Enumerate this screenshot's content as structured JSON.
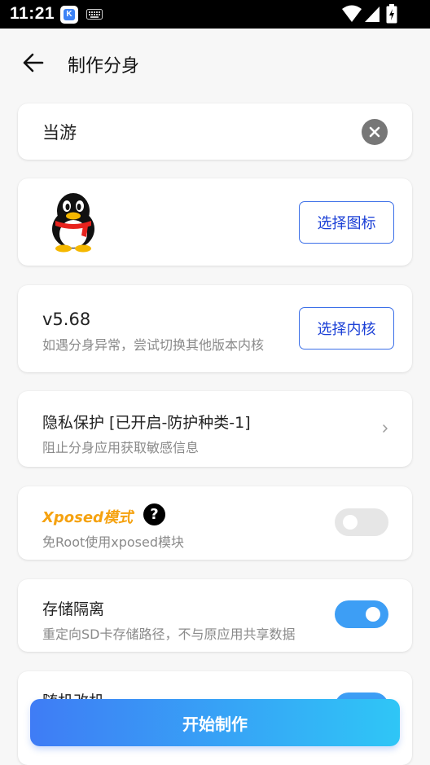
{
  "status_bar": {
    "time": "11:21",
    "app_icon_letter": "K",
    "icons": [
      "app-notification-icon",
      "keyboard-icon",
      "wifi-icon",
      "signal-icon",
      "battery-charging-icon"
    ]
  },
  "header": {
    "back_icon": "arrow-left-icon",
    "title": "制作分身"
  },
  "name_card": {
    "value": "当游",
    "clear_icon": "clear-circle-icon"
  },
  "icon_card": {
    "icon": "qq-penguin-icon",
    "button_label": "选择图标"
  },
  "core_card": {
    "version": "v5.68",
    "subtitle": "如遇分身异常，尝试切换其他版本内核",
    "button_label": "选择内核"
  },
  "privacy_card": {
    "title": "隐私保护 [已开启-防护种类-1]",
    "subtitle": "阻止分身应用获取敏感信息",
    "icon": "chevron-right-icon"
  },
  "xposed_card": {
    "title": "Xposed模式",
    "help_glyph": "?",
    "subtitle": "免Root使用xposed模块",
    "enabled": false
  },
  "storage_card": {
    "title": "存储隔离",
    "subtitle": "重定向SD卡存储路径，不与原应用共享数据",
    "enabled": true
  },
  "random_card": {
    "title": "随机改机",
    "enabled": true
  },
  "start_button": {
    "label": "开始制作"
  },
  "colors": {
    "accent_blue": "#3b6fe8",
    "toggle_on": "#3d9ef5",
    "xposed_orange": "#f5a210",
    "gradient_start": "#3f7cf5",
    "gradient_end": "#2fc6f6"
  }
}
